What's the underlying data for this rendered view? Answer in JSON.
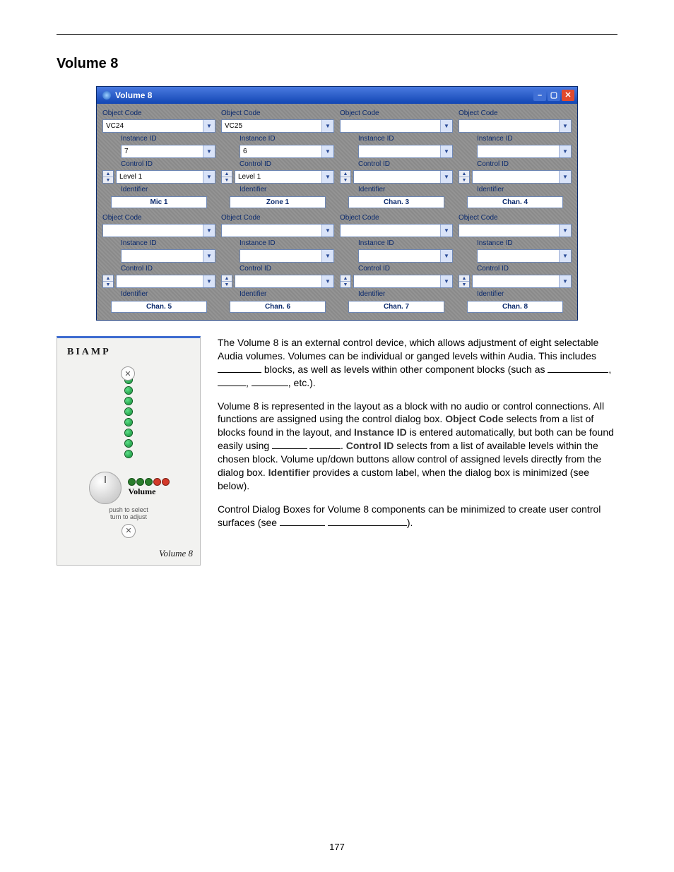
{
  "heading": "Volume 8",
  "dialog": {
    "title": "Volume 8",
    "labels": {
      "object_code": "Object Code",
      "instance_id": "Instance ID",
      "control_id": "Control ID",
      "identifier": "Identifier"
    },
    "channels": [
      {
        "object_code": "VC24",
        "instance_id": "7",
        "control_id": "Level 1",
        "identifier": "Mic 1"
      },
      {
        "object_code": "VC25",
        "instance_id": "6",
        "control_id": "Level 1",
        "identifier": "Zone 1"
      },
      {
        "object_code": "",
        "instance_id": "",
        "control_id": "",
        "identifier": "Chan. 3"
      },
      {
        "object_code": "",
        "instance_id": "",
        "control_id": "",
        "identifier": "Chan. 4"
      },
      {
        "object_code": "",
        "instance_id": "",
        "control_id": "",
        "identifier": "Chan. 5"
      },
      {
        "object_code": "",
        "instance_id": "",
        "control_id": "",
        "identifier": "Chan. 6"
      },
      {
        "object_code": "",
        "instance_id": "",
        "control_id": "",
        "identifier": "Chan. 7"
      },
      {
        "object_code": "",
        "instance_id": "",
        "control_id": "",
        "identifier": "Chan. 8"
      }
    ]
  },
  "device": {
    "brand": "BIAMP",
    "volume_label": "Volume",
    "push_text_1": "push to select",
    "push_text_2": "turn to adjust",
    "model": "Volume 8"
  },
  "body": {
    "p1a": "The Volume 8 is an external control device, which allows adjustment of eight selectable Audia volumes. Volumes can be individual or ganged levels within Audia. This includes ",
    "p1b": " blocks, as well as levels within other component blocks (such as ",
    "p1c": ", ",
    "p1d": ", ",
    "p1e": ", etc.).",
    "p2a": "Volume 8 is represented in the layout as a block with no audio or control connections. All functions are assigned using the control dialog box. ",
    "key_object_code": "Object Code",
    "p2b": " selects from a list of blocks found in the layout, and ",
    "key_instance_id": "Instance ID",
    "p2c": " is entered automatically, but both can be found easily using ",
    "p2d": ". ",
    "key_control_id": "Control ID",
    "p2e": " selects from a list of available levels within the chosen block. Volume up/down buttons allow control of assigned levels directly from the dialog box. ",
    "key_identifier": "Identifier",
    "p2f": " provides a custom label, when the dialog box is minimized (see below).",
    "p3a": "Control Dialog Boxes for Volume 8 components can be minimized to create user control surfaces (see ",
    "p3b": ")."
  },
  "page_number": "177"
}
